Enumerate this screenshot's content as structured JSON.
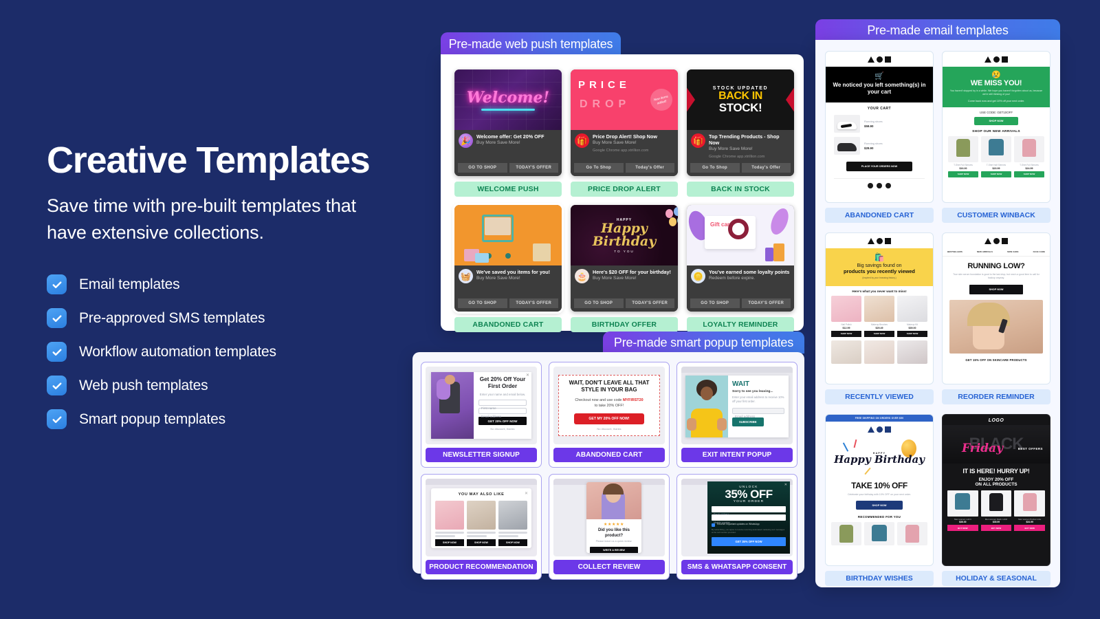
{
  "hero": {
    "title": "Creative Templates",
    "subtitle": "Save time with pre-built templates that have extensive collections.",
    "features": [
      {
        "label": "Email templates"
      },
      {
        "label": "Pre-approved SMS templates"
      },
      {
        "label": "Workflow automation templates"
      },
      {
        "label": "Web push templates"
      },
      {
        "label": "Smart popup templates"
      }
    ],
    "checkbox_color": "#3b8ef0",
    "background_color": "#1c2c69"
  },
  "web_push_panel": {
    "tab_label": "Pre-made web push templates",
    "accent_gradient": [
      "#7b3fe4",
      "#3f7ce8"
    ],
    "pill_bg": "#b5f0d2",
    "pill_text_color": "#0e8352",
    "cards": [
      {
        "pill": "WELCOME PUSH",
        "art_text": "Welcome!",
        "art_style": "neon-brick",
        "icon": "party-popper-icon",
        "title": "Welcome offer: Get 20% OFF",
        "subtitle": "Buy More Save More!",
        "source": "",
        "buttons": [
          "GO TO SHOP",
          "TODAY'S OFFER"
        ]
      },
      {
        "pill": "PRICE DROP ALERT",
        "art_text": "PRICE DROP",
        "art_badge": "New items added!",
        "art_style": "pink-type",
        "icon": "gift-icon",
        "title": "Price Drop Alert! Shop Now",
        "subtitle": "Buy More Save More!",
        "source": "Google Chrome  app.xtrillion.com",
        "buttons": [
          "Go To Shop",
          "Today's Offer"
        ]
      },
      {
        "pill": "BACK IN STOCK",
        "art_text_top": "STOCK UPDATED",
        "art_text_mid": "BACK IN",
        "art_text_bottom": "STOCK!",
        "art_style": "dark-arrows",
        "icon": "gift-icon",
        "title": "Top Trending Products - Shop Now",
        "subtitle": "Buy More Save More!",
        "source": "Google Chrome  app.xtrillion.com",
        "buttons": [
          "Go To Shop",
          "Today's Offer"
        ]
      },
      {
        "pill": "ABANDONED CART",
        "art_style": "orange-cart",
        "icon": "basket-icon",
        "title": "We've saved you items for you!",
        "subtitle": "Buy More Save More!",
        "source": "",
        "buttons": [
          "GO TO SHOP",
          "TODAY'S OFFER"
        ]
      },
      {
        "pill": "BIRTHDAY OFFER",
        "art_text": "Happy Birthday",
        "art_text_sub": "TO YOU",
        "art_style": "dark-balloons",
        "icon": "cake-icon",
        "title": "Here's $20 OFF for your birthday!",
        "subtitle": "Buy More Save More!",
        "source": "",
        "buttons": [
          "GO TO SHOP",
          "TODAY'S OFFER"
        ]
      },
      {
        "pill": "LOYALTY REMINDER",
        "art_text": "Gift card",
        "art_style": "gift-illustration",
        "icon": "coins-icon",
        "title": "You've earned some loyalty points",
        "subtitle": "Redeem before expire.",
        "source": "",
        "buttons": [
          "GO TO SHOP",
          "TODAY'S OFFER"
        ]
      }
    ]
  },
  "popup_panel": {
    "tab_label": "Pre-made smart popup templates",
    "pill_bg": "#6c38e8",
    "cards": [
      {
        "pill": "NEWSLETTER SIGNUP",
        "kind": "split-image-form",
        "heading": "Get 20% Off Your First Order",
        "sub": "Enter your name and email below.",
        "fields": [
          "First name",
          "Email address"
        ],
        "cta": "GET 20% OFF NOW",
        "decline": "No discount, thanks"
      },
      {
        "pill": "ABANDONED CART",
        "kind": "dashed-banner",
        "heading": "WAIT, DON'T LEAVE ALL THAT STYLE IN YOUR BAG",
        "sub_pre": "Checkout now and use code ",
        "code": "MYFIRST20",
        "sub_post": "to take 20% OFF!",
        "cta": "GET MY 20% OFF NOW!",
        "decline": "No discount, thanks"
      },
      {
        "pill": "EXIT INTENT POPUP",
        "kind": "exit-intent",
        "heading": "WAIT",
        "sub": "Sorry to see you leaving...",
        "body": "Enter your email address to receive 10% off your first order.",
        "fields": [
          "Email address"
        ],
        "cta": "SUBSCRIBE"
      },
      {
        "pill": "PRODUCT RECOMMENDATION",
        "kind": "product-grid",
        "heading": "YOU MAY ALSO LIKE",
        "cta": "SHOP NOW",
        "product_count": 3
      },
      {
        "pill": "COLLECT REVIEW",
        "kind": "review",
        "stars": 5,
        "heading": "Did you like this product?",
        "sub": "Please leave us a quick review.",
        "cta": "WRITE A REVIEW"
      },
      {
        "pill": "SMS & WHATSAPP CONSENT",
        "kind": "consent",
        "eyebrow": "UNLOCK",
        "heading": "35% OFF",
        "sub": "YOUR ORDER",
        "fields": [
          "Email address",
          "Mobile number"
        ],
        "consent": "Receive important updates on WhatsApp",
        "fineprint": "By subscribing, you agree to receive recurring automated marketing text messages at the cell number provided.",
        "cta": "GET 35% OFF NOW"
      }
    ]
  },
  "email_panel": {
    "tab_label": "Pre-made email templates",
    "pill_bg": "#dceafc",
    "pill_text_color": "#2763d4",
    "cards": [
      {
        "pill": "ABANDONED CART",
        "kind": "abandoned-cart",
        "hero_icon": "shopping-cart-icon",
        "hero_title": "We noticed you left something(s) in your cart",
        "section_title": "YOUR CART",
        "items": [
          {
            "name": "Running shoes",
            "price": "$59.90"
          },
          {
            "name": "Running shoes",
            "price": "$29.90"
          }
        ],
        "cta": "PLACE YOUR ORDERS NOW",
        "social": [
          "facebook-icon",
          "twitter-icon",
          "instagram-icon"
        ]
      },
      {
        "pill": "CUSTOMER WINBACK",
        "kind": "winback",
        "emoji": "sad-face-emoji",
        "hero_title": "WE MISS YOU!",
        "body": "You haven't stopped by in a while. We hope you haven't forgotten about us, because we're still thinking of you!",
        "body2": "Come back now and get 10% off your next order.",
        "code_label": "USE CODE: GET10OFF",
        "cta": "SHOP NOW",
        "section_title": "SHOP OUR NEW ARRIVALS",
        "products": [
          {
            "name": "T-Shirt Full Sleeves",
            "price": "$16.00",
            "cta": "SHOP NOW"
          },
          {
            "name": "T-Shirt Half Sleeves",
            "price": "$23.99",
            "cta": "SHOP NOW"
          },
          {
            "name": "T-Shirt Full Sleeves",
            "price": "$24.99",
            "cta": "SHOP NOW"
          }
        ]
      },
      {
        "pill": "RECENTLY VIEWED",
        "kind": "recently-viewed",
        "hero_icon": "shopping-bag-icon",
        "hero_title_1": "Big savings found on",
        "hero_title_2": "products you recently viewed",
        "hero_sub": "(Inspired by your browsing history.)",
        "section_title": "Here's what you never want to miss!",
        "products": [
          {
            "name": "Nail Polish",
            "price": "$12.99",
            "cta": "SHOP NOW"
          },
          {
            "name": "Makeup Brushes",
            "price": "$29.49",
            "cta": "SHOP NOW"
          },
          {
            "name": "Makeup Kit",
            "price": "$39.00",
            "cta": "SHOP NOW"
          }
        ]
      },
      {
        "pill": "REORDER REMINDER",
        "kind": "reorder",
        "nav": [
          "BESTSELLERS",
          "NEW ARRIVALS",
          "SKIN CARE",
          "FACE CARE"
        ],
        "hero_title": "RUNNING LOW?",
        "body": "True skin serum foundation is good to the last drop, but now's a good time to call for backup anyway.",
        "cta": "SHOP NOW",
        "footer": "GET 15% OFF ON SKINCARE PRODUCTS"
      },
      {
        "pill": "BIRTHDAY WISHES",
        "kind": "birthday",
        "banner": "FREE SHIPPING ON ORDERS OVER $50",
        "art_text": "Happy Birthday",
        "hero_title": "TAKE 10% OFF",
        "body": "Celebrate your birthday with 10% OFF on your next order.",
        "cta": "SHOP NOW",
        "section_title": "RECOMMENDED FOR YOU"
      },
      {
        "pill": "HOLIDAY & SEASONAL",
        "kind": "black-friday",
        "logo": "LOGO",
        "art_text": "BLACK",
        "art_script": "Friday",
        "art_tag": "BEST OFFERS",
        "hero_title": "IT IS HERE! HURRY UP!",
        "sub_1": "ENJOY 20% OFF",
        "sub_2": "ON ALL PRODUCTS",
        "products": [
          {
            "name": "Men women t-shirt",
            "price": "$36.00",
            "cta": "BUY NOW"
          },
          {
            "name": "Men women black t-shirt",
            "price": "$35.99",
            "cta": "BUY NOW"
          },
          {
            "name": "Men women Pocket robe",
            "price": "$34.99",
            "cta": "BUY NOW"
          }
        ]
      }
    ]
  }
}
